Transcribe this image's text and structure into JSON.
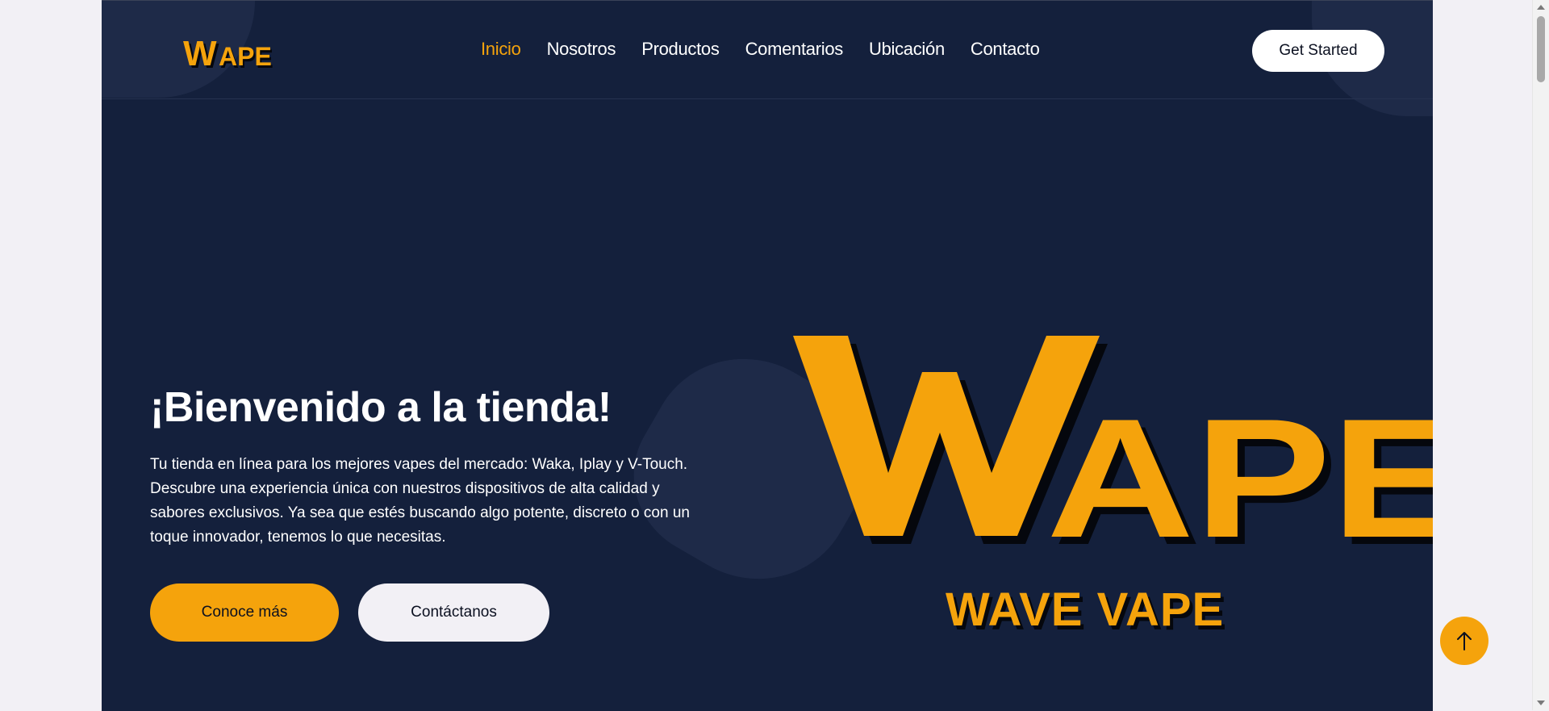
{
  "brand": {
    "logo_text": "WAPE",
    "tagline": "WAVE VAPE",
    "accent_color": "#f5a30c",
    "background_color": "#14203c"
  },
  "nav": {
    "items": [
      {
        "label": "Inicio",
        "active": true
      },
      {
        "label": "Nosotros",
        "active": false
      },
      {
        "label": "Productos",
        "active": false
      },
      {
        "label": "Comentarios",
        "active": false
      },
      {
        "label": "Ubicación",
        "active": false
      },
      {
        "label": "Contacto",
        "active": false
      }
    ],
    "cta_label": "Get Started"
  },
  "hero": {
    "title": "¡Bienvenido a la tienda!",
    "lines": [
      "Tu tienda en línea para los mejores vapes del mercado: Waka, Iplay y V-Touch.",
      "Descubre una experiencia única con nuestros dispositivos de alta calidad y",
      "sabores exclusivos. Ya sea que estés buscando algo potente, discreto o con un",
      "toque innovador, tenemos lo que necesitas."
    ],
    "primary_button": "Conoce más",
    "secondary_button": "Contáctanos"
  },
  "icons": {
    "scroll_top": "arrow-up-icon"
  }
}
